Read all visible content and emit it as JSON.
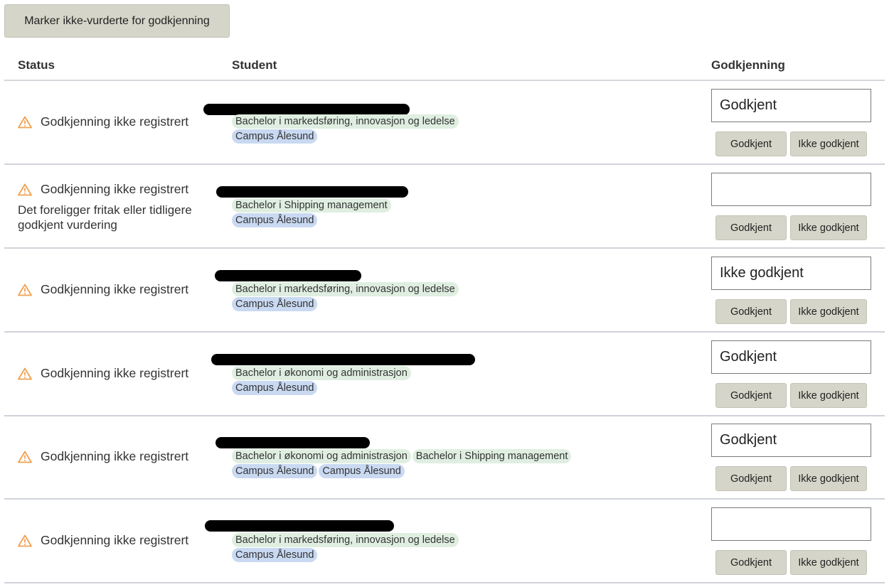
{
  "toolbar": {
    "mark_button": "Marker ikke-vurderte for godkjenning"
  },
  "columns": {
    "status": "Status",
    "student": "Student",
    "approval": "Godkjenning"
  },
  "colors": {
    "warning": "#f0a050",
    "program_tag": "#dfeee0",
    "campus_tag": "#c9d9f2",
    "button": "#d6d5c9"
  },
  "rows": [
    {
      "status": "Godkjenning ikke registrert",
      "note": "",
      "programs": [
        "Bachelor i markedsføring, innovasjon og ledelse"
      ],
      "campuses": [
        "Campus Ålesund"
      ],
      "approval_value": "Godkjent",
      "approve_label": "Godkjent",
      "reject_label": "Ikke godkjent"
    },
    {
      "status": "Godkjenning ikke registrert",
      "note": "Det foreligger fritak eller tidligere godkjent vurdering",
      "programs": [
        "Bachelor i Shipping management"
      ],
      "campuses": [
        "Campus Ålesund"
      ],
      "approval_value": "",
      "approve_label": "Godkjent",
      "reject_label": "Ikke godkjent"
    },
    {
      "status": "Godkjenning ikke registrert",
      "note": "",
      "programs": [
        "Bachelor i markedsføring, innovasjon og ledelse"
      ],
      "campuses": [
        "Campus Ålesund"
      ],
      "approval_value": "Ikke godkjent",
      "approve_label": "Godkjent",
      "reject_label": "Ikke godkjent"
    },
    {
      "status": "Godkjenning ikke registrert",
      "note": "",
      "programs": [
        "Bachelor i økonomi og administrasjon"
      ],
      "campuses": [
        "Campus Ålesund"
      ],
      "approval_value": "Godkjent",
      "approve_label": "Godkjent",
      "reject_label": "Ikke godkjent"
    },
    {
      "status": "Godkjenning ikke registrert",
      "note": "",
      "programs": [
        "Bachelor i økonomi og administrasjon",
        "Bachelor i Shipping management"
      ],
      "campuses": [
        "Campus Ålesund",
        "Campus Ålesund"
      ],
      "approval_value": "Godkjent",
      "approve_label": "Godkjent",
      "reject_label": "Ikke godkjent"
    },
    {
      "status": "Godkjenning ikke registrert",
      "note": "",
      "programs": [
        "Bachelor i markedsføring, innovasjon og ledelse"
      ],
      "campuses": [
        "Campus Ålesund"
      ],
      "approval_value": "",
      "approve_label": "Godkjent",
      "reject_label": "Ikke godkjent"
    }
  ]
}
